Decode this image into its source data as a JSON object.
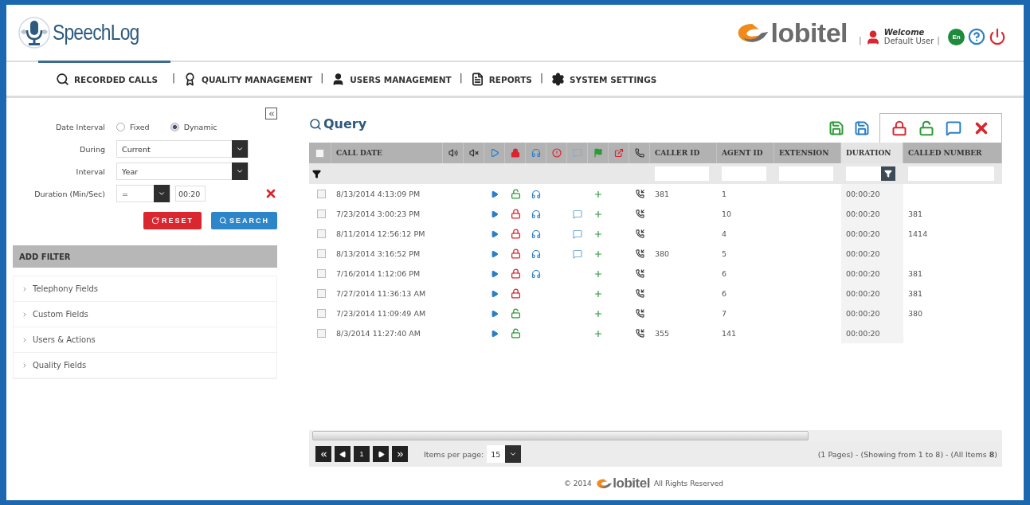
{
  "header": {
    "logo_text": "SpeechLog",
    "brand_text": "lobitel",
    "separators": [
      "|",
      "|"
    ],
    "welcome": "Welcome",
    "user": "Default User",
    "language": "En"
  },
  "nav": {
    "items": [
      {
        "label": "RECORDED CALLS",
        "selected": true
      },
      {
        "label": "QUALITY MANAGEMENT",
        "selected": false
      },
      {
        "label": "USERS MANAGEMENT",
        "selected": false
      },
      {
        "label": "REPORTS",
        "selected": false
      },
      {
        "label": "SYSTEM SETTINGS",
        "selected": false
      }
    ],
    "separators": [
      "|",
      "|",
      "|",
      "|"
    ]
  },
  "filters": {
    "date_interval": {
      "label": "Date Interval",
      "options": [
        {
          "label": "Fixed",
          "selected": false
        },
        {
          "label": "Dynamic",
          "selected": true
        }
      ]
    },
    "during": {
      "label": "During",
      "value": "Current"
    },
    "interval": {
      "label": "Interval",
      "value": "Year"
    },
    "duration": {
      "label": "Duration (Min/Sec)",
      "operator": "=",
      "value": "00:20"
    },
    "buttons": [
      {
        "label": "RESET",
        "kind": "reset"
      },
      {
        "label": "SEARCH",
        "kind": "search"
      }
    ]
  },
  "add_filter": {
    "title": "ADD FILTER",
    "groups": [
      {
        "label": "Telephony Fields",
        "expanded": false
      },
      {
        "label": "Custom Fields",
        "expanded": false
      },
      {
        "label": "Users & Actions",
        "expanded": false
      },
      {
        "label": "Quality Fields",
        "expanded": false
      }
    ]
  },
  "query": {
    "title": "Query"
  },
  "table": {
    "all_checked": false,
    "columns": [
      {
        "label": "CALL DATE",
        "highlighted": false
      },
      {
        "label": "CALLER ID",
        "highlighted": false
      },
      {
        "label": "AGENT ID",
        "highlighted": false
      },
      {
        "label": "EXTENSION",
        "highlighted": false
      },
      {
        "label": "DURATION",
        "highlighted": true
      },
      {
        "label": "CALLED NUMBER",
        "highlighted": false
      }
    ],
    "rows": [
      {
        "checked": false,
        "call_date": "8/13/2014 4:13:09 PM",
        "locked": false,
        "listened": true,
        "commented": false,
        "caller_id": "381",
        "agent_id": "1",
        "duration": "00:00:20"
      },
      {
        "checked": false,
        "call_date": "7/23/2014 3:00:23 PM",
        "locked": true,
        "listened": true,
        "commented": true,
        "agent_id": "10",
        "duration": "00:00:20",
        "called_number": "381"
      },
      {
        "checked": false,
        "call_date": "8/11/2014 12:56:12 PM",
        "locked": true,
        "listened": true,
        "commented": true,
        "agent_id": "4",
        "duration": "00:00:20",
        "called_number": "1414"
      },
      {
        "checked": false,
        "call_date": "8/13/2014 3:16:52 PM",
        "locked": true,
        "listened": true,
        "commented": true,
        "caller_id": "380",
        "agent_id": "5",
        "duration": "00:00:20"
      },
      {
        "checked": false,
        "call_date": "7/16/2014 1:12:06 PM",
        "locked": true,
        "listened": true,
        "commented": false,
        "agent_id": "6",
        "duration": "00:00:20",
        "called_number": "381"
      },
      {
        "checked": false,
        "call_date": "7/27/2014 11:36:13 AM",
        "locked": true,
        "listened": false,
        "commented": false,
        "agent_id": "6",
        "duration": "00:00:20",
        "called_number": "381"
      },
      {
        "checked": false,
        "call_date": "7/23/2014 11:09:49 AM",
        "locked": false,
        "listened": false,
        "commented": false,
        "agent_id": "7",
        "duration": "00:00:20",
        "called_number": "380"
      },
      {
        "checked": false,
        "call_date": "8/3/2014 11:27:40 AM",
        "locked": false,
        "listened": false,
        "commented": false,
        "caller_id": "355",
        "agent_id": "141",
        "duration": "00:00:20"
      }
    ]
  },
  "pager": {
    "current_page": "1",
    "items_per_page_label": "Items per page:",
    "items_per_page": "15",
    "summary": "(1 Pages) - (Showing from 1 to 8) - (All Items **8**)"
  },
  "footer": {
    "copyright": "© 2014",
    "brand_text": "lobitel",
    "rights": "All Rights Reserved"
  }
}
